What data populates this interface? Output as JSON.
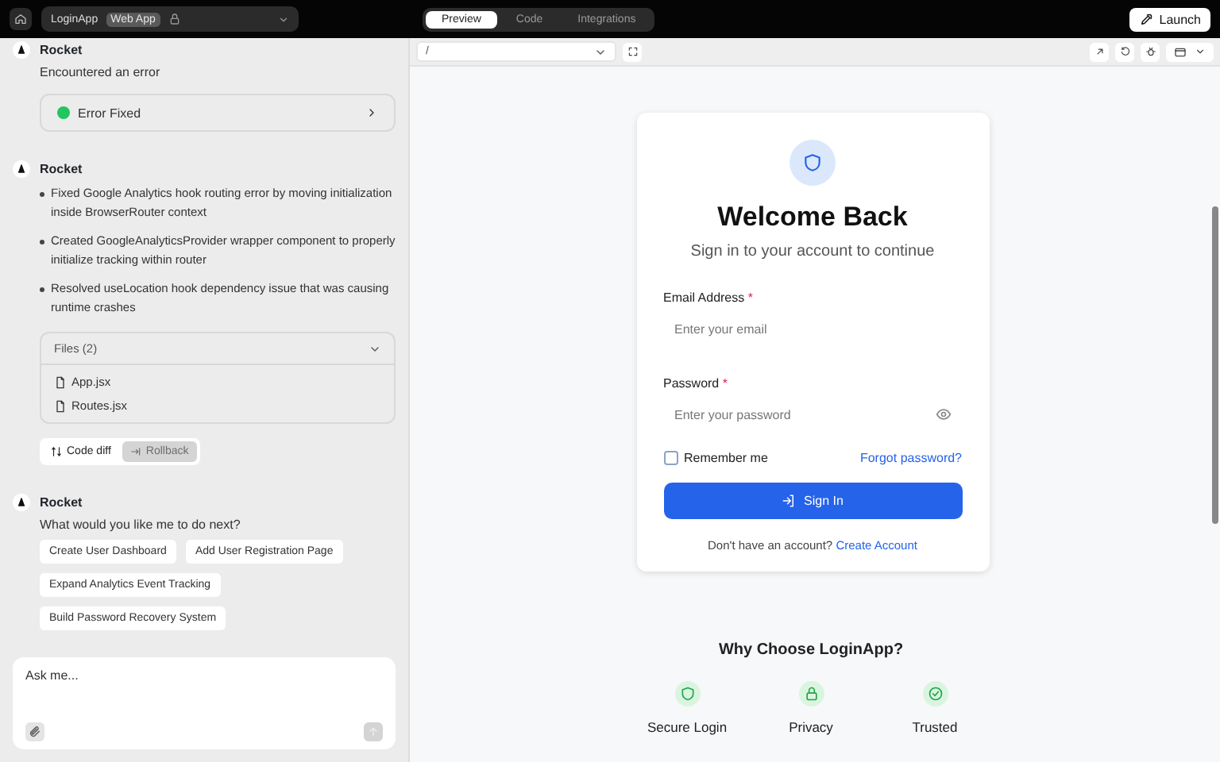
{
  "top_bar": {
    "project": "LoginApp",
    "badge": "Web App",
    "tabs": [
      {
        "label": "Preview",
        "selected": true
      },
      {
        "label": "Code",
        "selected": false
      },
      {
        "label": "Integrations",
        "selected": false
      }
    ],
    "launch": "Launch"
  },
  "chat": {
    "messages": [
      {
        "kind": "status",
        "author": "Rocket",
        "text": "Encountered an error",
        "status": "Error Fixed",
        "color": "#22c55e"
      },
      {
        "kind": "summary",
        "author": "Rocket",
        "bullets": [
          "Fixed Google Analytics hook routing error by moving initialization inside BrowserRouter context",
          "Created GoogleAnalyticsProvider wrapper component to properly initialize tracking within router",
          "Resolved useLocation hook dependency issue that was causing runtime crashes"
        ],
        "files_title": "Files (2)",
        "expanded": true,
        "files": [
          "App.jsx",
          "Routes.jsx"
        ],
        "actions": [
          {
            "label": "Code diff",
            "disabled": false
          },
          {
            "label": "Rollback",
            "disabled": true
          }
        ]
      },
      {
        "kind": "suggestions",
        "author": "Rocket",
        "text": "What would you like me to do next?",
        "suggestions": [
          "Create User Dashboard",
          "Add User Registration Page",
          "Expand Analytics Event Tracking",
          "Build Password Recovery System"
        ]
      }
    ],
    "input": {
      "placeholder": "Ask me..."
    }
  },
  "preview": {
    "url": "/",
    "card": {
      "title": "Welcome Back",
      "subtitle": "Sign in to your account to continue",
      "fields": [
        {
          "label": "Email Address",
          "required": "*",
          "placeholder": "Enter your email",
          "kind": "email"
        },
        {
          "label": "Password",
          "required": "*",
          "placeholder": "Enter your password",
          "kind": "password"
        }
      ],
      "remember": {
        "label": "Remember me",
        "checked": false
      },
      "forgot": "Forgot password?",
      "submit": "Sign In",
      "footer": "Don't have an account?",
      "footer_link": "Create Account"
    },
    "features": {
      "title": "Why Choose LoginApp?",
      "items": [
        {
          "kind": "shield",
          "label": "Secure Login"
        },
        {
          "kind": "lock",
          "label": "Privacy"
        },
        {
          "kind": "check",
          "label": "Trusted"
        }
      ]
    }
  }
}
